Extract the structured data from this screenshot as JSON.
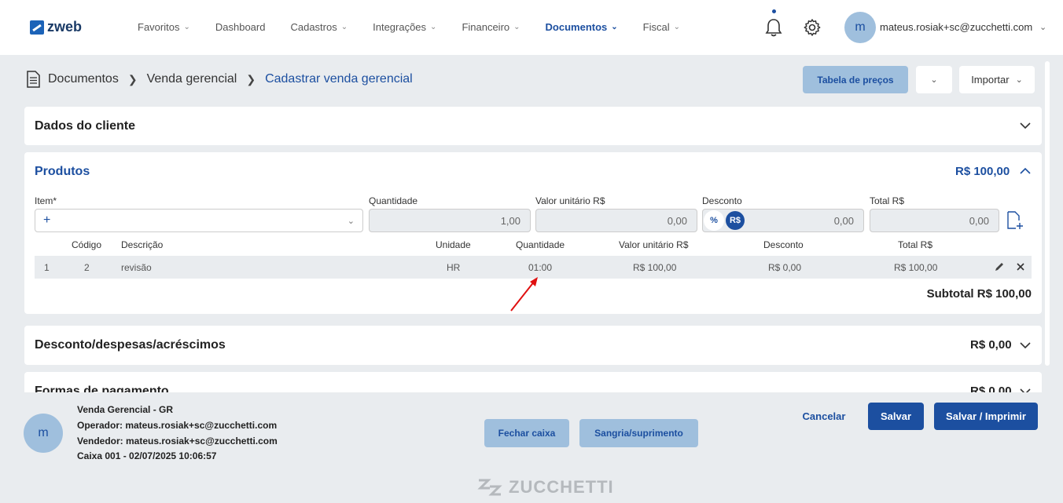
{
  "app": {
    "logo_text": "zweb"
  },
  "nav": {
    "items": [
      {
        "label": "Favoritos",
        "active": false,
        "has_menu": true
      },
      {
        "label": "Dashboard",
        "active": false,
        "has_menu": false
      },
      {
        "label": "Cadastros",
        "active": false,
        "has_menu": true
      },
      {
        "label": "Integrações",
        "active": false,
        "has_menu": true
      },
      {
        "label": "Financeiro",
        "active": false,
        "has_menu": true
      },
      {
        "label": "Documentos",
        "active": true,
        "has_menu": true
      },
      {
        "label": "Fiscal",
        "active": false,
        "has_menu": true
      }
    ],
    "user_initial": "m",
    "user_email": "mateus.rosiak+sc@zucchetti.com",
    "icons": [
      "bell-icon",
      "gear-icon",
      "chevron-down-icon"
    ]
  },
  "breadcrumb": {
    "items": [
      "Documentos",
      "Venda gerencial"
    ],
    "current": "Cadastrar venda gerencial"
  },
  "actions": {
    "tabela_label": "Tabela de preços",
    "importar_label": "Importar"
  },
  "cliente": {
    "title": "Dados do cliente"
  },
  "produtos": {
    "title": "Produtos",
    "total": "R$ 100,00",
    "form": {
      "item_label": "Item*",
      "item_plus": "+",
      "quantidade_label": "Quantidade",
      "quantidade_value": "1,00",
      "valor_label": "Valor unitário R$",
      "valor_value": "0,00",
      "desconto_label": "Desconto",
      "desconto_pct": "%",
      "desconto_rs": "R$",
      "desconto_value": "0,00",
      "total_label": "Total R$",
      "total_value": "0,00"
    },
    "columns": [
      "Código",
      "Descrição",
      "Unidade",
      "Quantidade",
      "Valor unitário R$",
      "Desconto",
      "Total R$"
    ],
    "rows": [
      {
        "n": "1",
        "codigo": "2",
        "descricao": "revisão",
        "unidade": "HR",
        "quantidade": "01:00",
        "valor": "R$ 100,00",
        "desconto": "R$ 0,00",
        "total": "R$ 100,00"
      }
    ],
    "subtotal": "Subtotal R$ 100,00"
  },
  "desconto": {
    "title": "Desconto/despesas/acréscimos",
    "value": "R$ 0,00"
  },
  "pagamento": {
    "title": "Formas de pagamento",
    "value": "R$ 0,00"
  },
  "footer": {
    "avatar": "m",
    "line1": "Venda Gerencial - GR",
    "line2": "Operador: mateus.rosiak+sc@zucchetti.com",
    "line3": "Vendedor: mateus.rosiak+sc@zucchetti.com",
    "line4": "Caixa 001 - 02/07/2025 10:06:57",
    "fechar_caixa": "Fechar caixa",
    "sangria": "Sangria/suprimento",
    "cancelar": "Cancelar",
    "salvar": "Salvar",
    "salvar_imprimir": "Salvar / Imprimir",
    "brand": "ZUCCHETTI"
  },
  "colors": {
    "primary": "#1c4fa0",
    "light_button": "#9fbfdd",
    "background": "#e9ecef",
    "annotation_arrow": "#e01010"
  }
}
